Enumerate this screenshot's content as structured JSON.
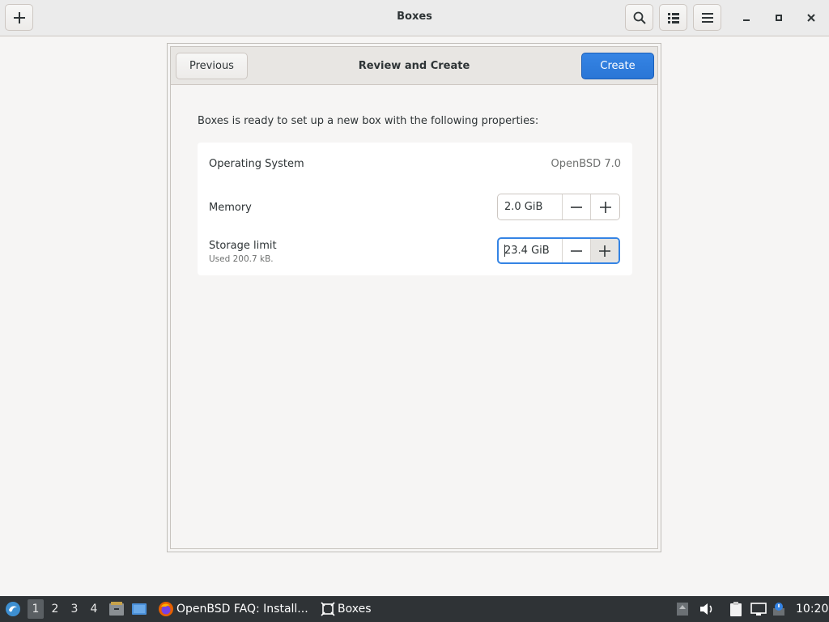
{
  "header": {
    "title": "Boxes",
    "add_icon": "plus-icon",
    "search_icon": "search-icon",
    "view_icon": "list-view-icon",
    "menu_icon": "hamburger-menu-icon"
  },
  "dialog": {
    "title": "Review and Create",
    "previous_label": "Previous",
    "create_label": "Create",
    "intro": "Boxes is ready to set up a new box with the following properties:",
    "os": {
      "label": "Operating System",
      "value": "OpenBSD 7.0"
    },
    "memory": {
      "label": "Memory",
      "value": "2.0 GiB"
    },
    "storage": {
      "label": "Storage limit",
      "sub": "Used 200.7 kB.",
      "value": "23.4 GiB"
    }
  },
  "taskbar": {
    "workspaces": [
      "1",
      "2",
      "3",
      "4"
    ],
    "active_workspace": "1",
    "tasks": [
      {
        "label": "OpenBSD FAQ: Install...",
        "icon": "firefox-icon"
      },
      {
        "label": "Boxes",
        "icon": "boxes-icon"
      }
    ],
    "clock": "10:20"
  },
  "colors": {
    "accent": "#3584e4",
    "taskbar": "#2f3336"
  }
}
